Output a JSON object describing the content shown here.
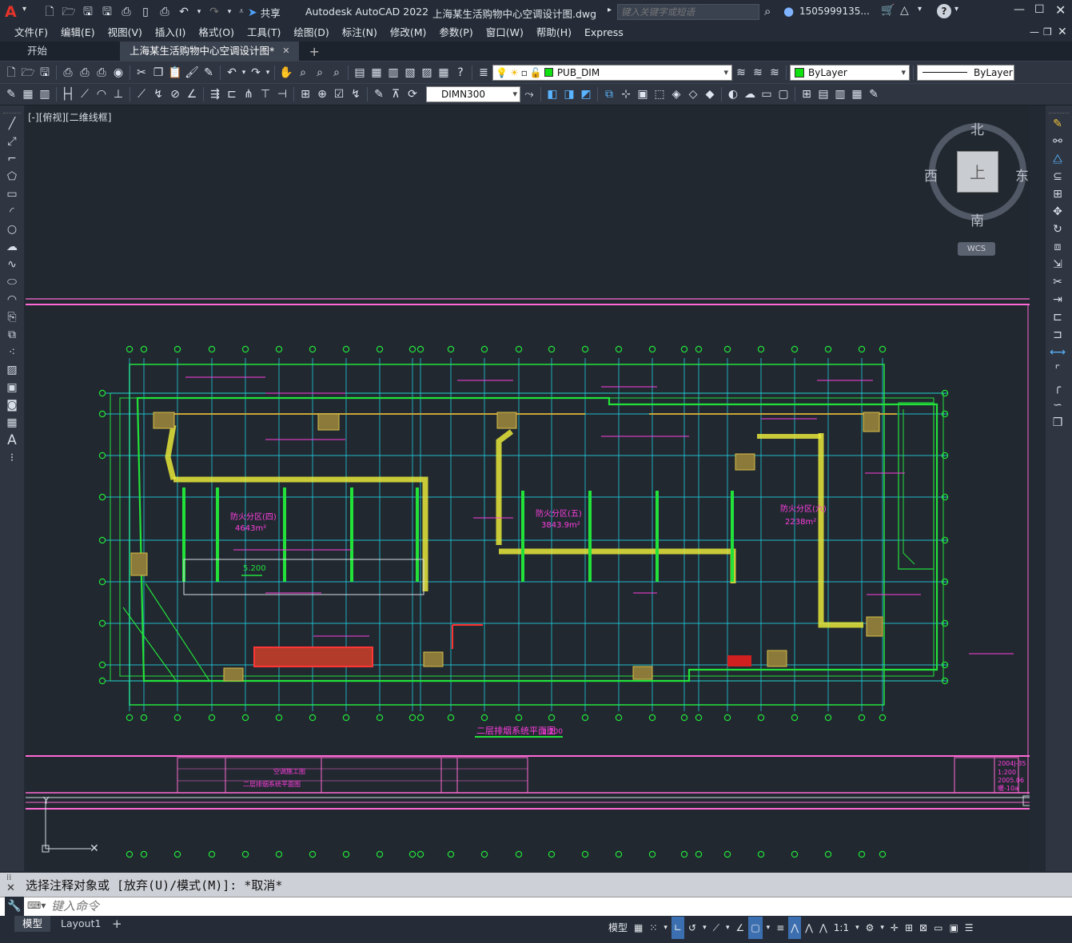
{
  "app": {
    "title": "Autodesk AutoCAD 2022",
    "document": "上海某生活购物中心空调设计图.dwg",
    "search_placeholder": "键入关键字或短语",
    "share_label": "共享",
    "user": "1505999135...",
    "logo_glyph": "A"
  },
  "menu": [
    "文件(F)",
    "编辑(E)",
    "视图(V)",
    "插入(I)",
    "格式(O)",
    "工具(T)",
    "绘图(D)",
    "标注(N)",
    "修改(M)",
    "参数(P)",
    "窗口(W)",
    "帮助(H)",
    "Express"
  ],
  "file_tabs": [
    {
      "label": "开始",
      "active": false
    },
    {
      "label": "上海某生活购物中心空调设计图*",
      "active": true
    }
  ],
  "toolbar": {
    "layer_name": "PUB_DIM",
    "color_value": "ByLayer",
    "linetype_value": "ByLayer",
    "dimstyle_value": "DIMN300",
    "layer_color": "#10e010"
  },
  "viewport": {
    "label": "[-][俯视][二维线框]",
    "viewcube": {
      "north": "北",
      "south": "南",
      "east": "东",
      "west": "西",
      "face": "上",
      "ucs": "WCS"
    }
  },
  "drawing": {
    "title": "二层排烟系统平面图",
    "scale_label": "1:200",
    "zones": [
      {
        "name": "防火分区(四)",
        "area": "4643m²"
      },
      {
        "name": "防火分区(五)",
        "area": "3843.9m²"
      },
      {
        "name": "防火分区(六)",
        "area": "2238m²"
      }
    ],
    "elevation": "5.200",
    "titleblock": {
      "sheet_name": "二层排烟系统平面图",
      "project": "空调施工图",
      "number": "2004J-35",
      "scale": "1:200",
      "date": "2005.06",
      "sheet_no": "暖-10a"
    }
  },
  "command": {
    "history": "选择注释对象或 [放弃(U)/模式(M)]: *取消*",
    "placeholder": "键入命令"
  },
  "layout_tabs": [
    "模型",
    "Layout1"
  ],
  "status": {
    "model_label": "模型",
    "scale": "1:1"
  },
  "colors": {
    "grid_cyan": "#21d4e6",
    "wall_green": "#22e23a",
    "magenta": "#ff3fe0",
    "duct_yellow": "#e6e63a",
    "border_pink": "#ff6ad5"
  }
}
